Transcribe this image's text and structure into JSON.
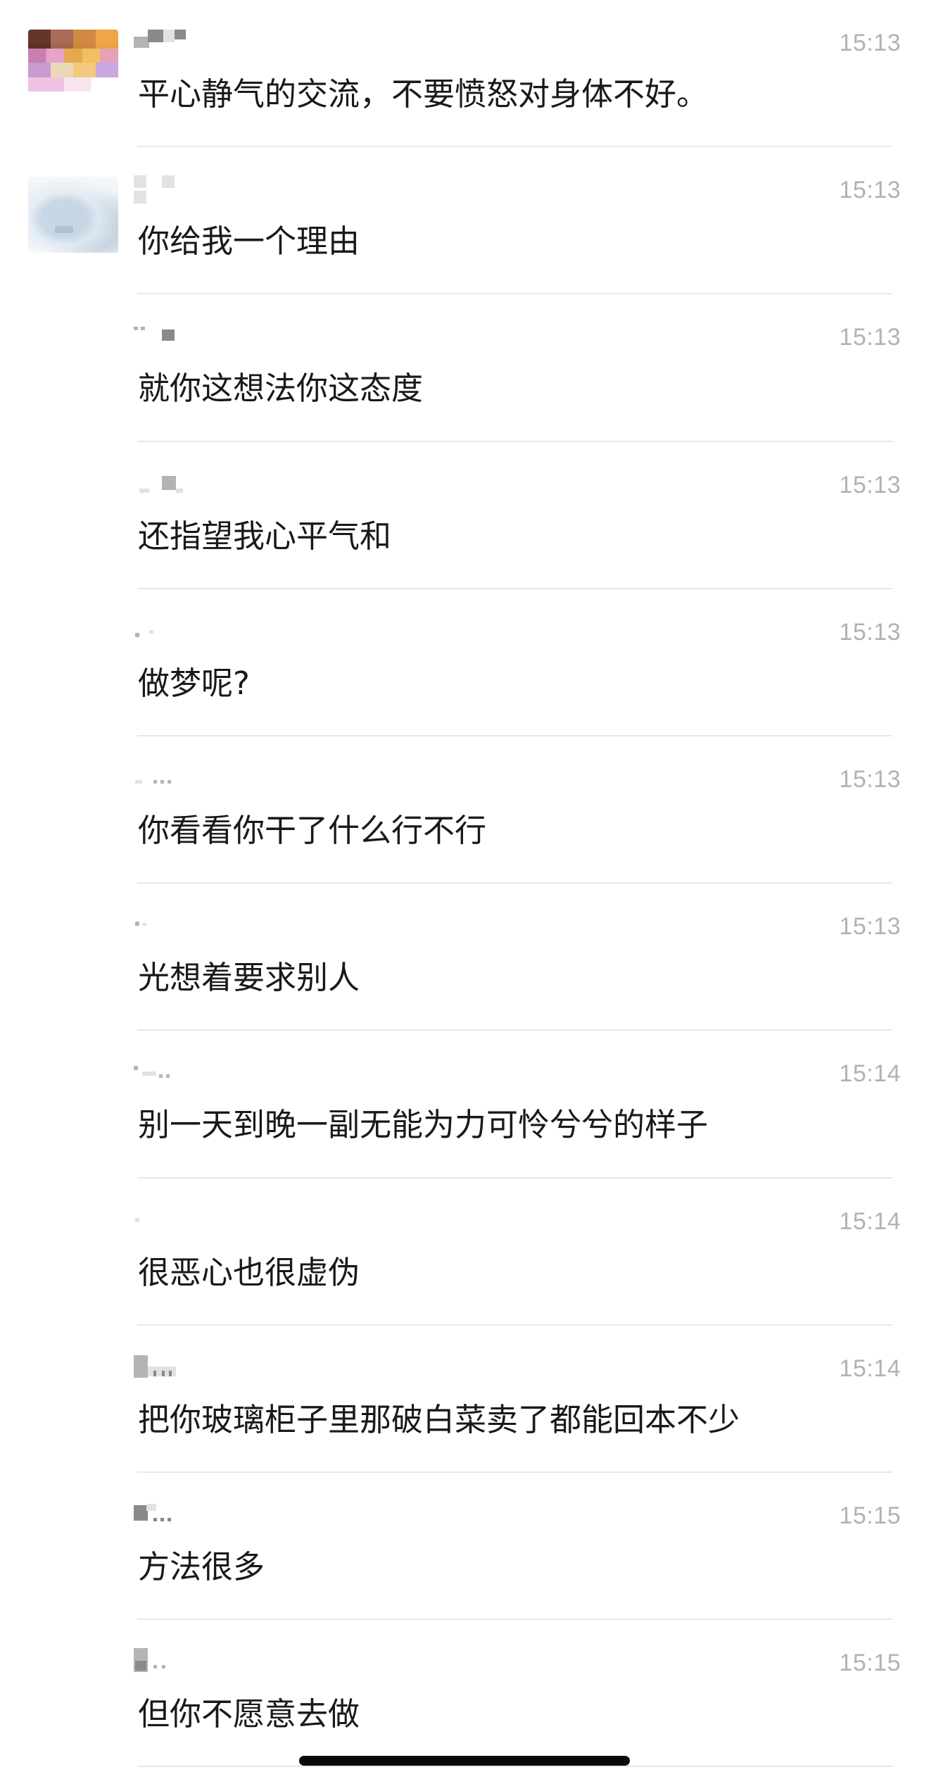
{
  "chat": {
    "messages": [
      {
        "time": "15:13",
        "text": "平心静气的交流，不要愤怒对身体不好。",
        "avatar": "blurred-colorful-avatar"
      },
      {
        "time": "15:13",
        "text": "你给我一个理由",
        "avatar": "blurred-light-avatar"
      },
      {
        "time": "15:13",
        "text": "就你这想法你这态度",
        "avatar": ""
      },
      {
        "time": "15:13",
        "text": "还指望我心平气和",
        "avatar": ""
      },
      {
        "time": "15:13",
        "text": "做梦呢?",
        "avatar": ""
      },
      {
        "time": "15:13",
        "text": "你看看你干了什么行不行",
        "avatar": ""
      },
      {
        "time": "15:13",
        "text": "光想着要求别人",
        "avatar": ""
      },
      {
        "time": "15:14",
        "text": "别一天到晚一副无能为力可怜兮兮的样子",
        "avatar": ""
      },
      {
        "time": "15:14",
        "text": "很恶心也很虚伪",
        "avatar": ""
      },
      {
        "time": "15:14",
        "text": "把你玻璃柜子里那破白菜卖了都能回本不少",
        "avatar": ""
      },
      {
        "time": "15:15",
        "text": "方法很多",
        "avatar": ""
      },
      {
        "time": "15:15",
        "text": "但你不愿意去做",
        "avatar": ""
      }
    ]
  },
  "colors": {
    "message_text": "#191919",
    "timestamp": "#b2b2b2",
    "divider": "#e7e7e7",
    "background": "#ffffff",
    "home_indicator": "#0a0a0a"
  }
}
